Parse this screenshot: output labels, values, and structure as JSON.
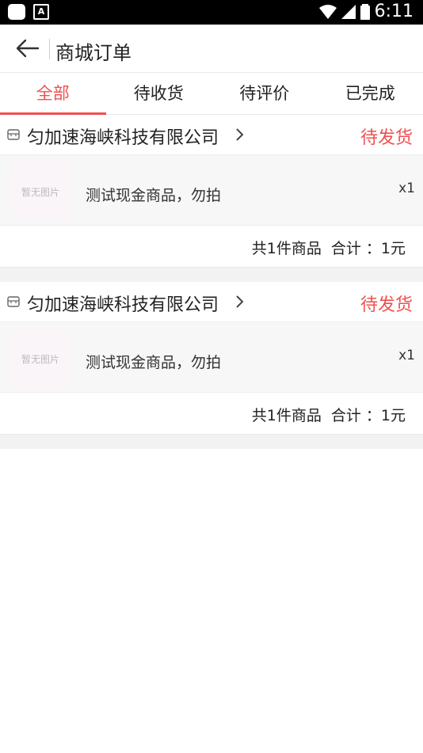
{
  "status_bar": {
    "time": "6:11",
    "a_label": "A"
  },
  "header": {
    "title": "商城订单"
  },
  "tabs": [
    {
      "label": "全部",
      "active": true
    },
    {
      "label": "待收货",
      "active": false
    },
    {
      "label": "待评价",
      "active": false
    },
    {
      "label": "已完成",
      "active": false
    }
  ],
  "orders": [
    {
      "shop_name": "匀加速海峡科技有限公司",
      "status": "待发货",
      "thumb_placeholder": "暂无图片",
      "item_name": "测试现金商品，勿拍",
      "quantity": "x1",
      "summary_count": "共1件商品",
      "summary_total": "合计 ：1元"
    },
    {
      "shop_name": "匀加速海峡科技有限公司",
      "status": "待发货",
      "thumb_placeholder": "暂无图片",
      "item_name": "测试现金商品，勿拍",
      "quantity": "x1",
      "summary_count": "共1件商品",
      "summary_total": "合计 ：1元"
    }
  ],
  "colors": {
    "accent": "#f05050",
    "background_gap": "#f2f2f2"
  }
}
